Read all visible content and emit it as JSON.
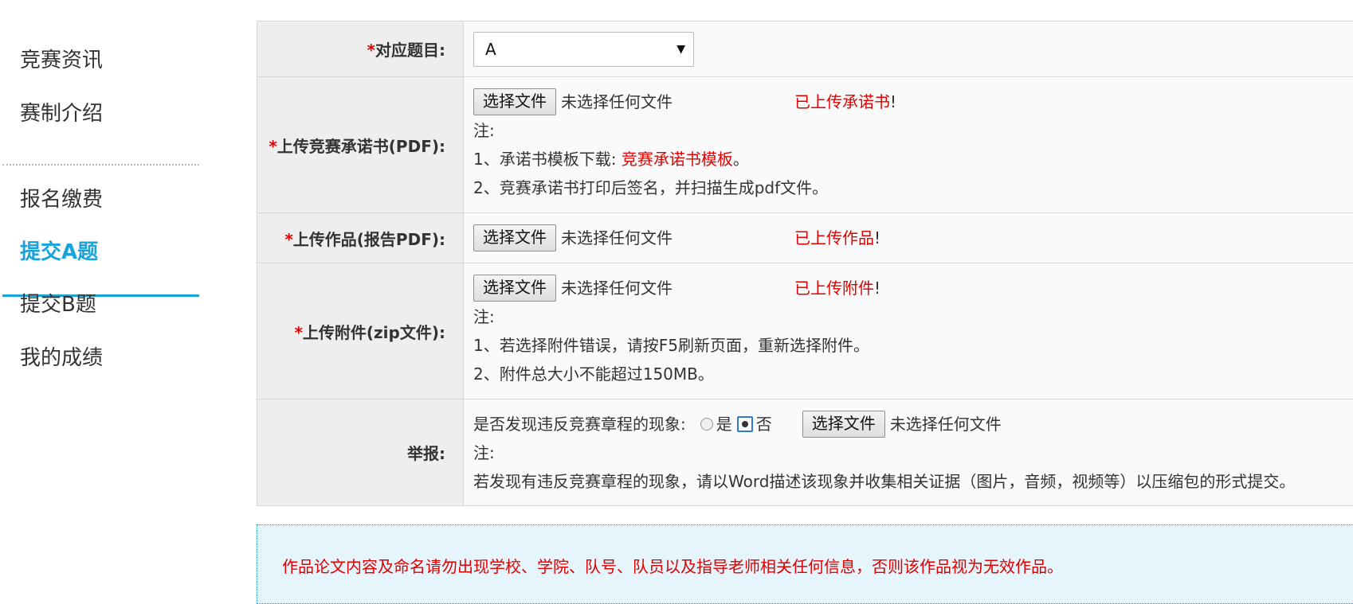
{
  "sidebar": {
    "items": [
      {
        "label": "竞赛资讯"
      },
      {
        "label": "赛制介绍"
      },
      {
        "label": "报名缴费"
      },
      {
        "label": "提交A题"
      },
      {
        "label": "提交B题"
      },
      {
        "label": "我的成绩"
      }
    ],
    "active_index": 3
  },
  "form": {
    "required_mark": "*",
    "topic": {
      "label": "对应题目:",
      "selected": "A",
      "arrow": "▼"
    },
    "file_button": "选择文件",
    "no_file": "未选择任何文件",
    "commitment": {
      "label": "上传竞赛承诺书(PDF):",
      "status": "已上传承诺书",
      "note_title": "注:",
      "note1_prefix": "1、承诺书模板下载:",
      "note1_link": "竞赛承诺书模板",
      "note1_suffix": "。",
      "note2": "2、竞赛承诺书打印后签名，并扫描生成pdf文件。"
    },
    "work": {
      "label": "上传作品(报告PDF):",
      "status": "已上传作品"
    },
    "attachment": {
      "label": "上传附件(zip文件):",
      "status": "已上传附件",
      "note_title": "注:",
      "note1": "1、若选择附件错误，请按F5刷新页面，重新选择附件。",
      "note2": "2、附件总大小不能超过150MB。"
    },
    "report": {
      "label": "举报:",
      "question": "是否发现违反竞赛章程的现象:",
      "yes": "是",
      "no": "否",
      "selected": "否",
      "note_title": "注:",
      "note": "若发现有违反竞赛章程的现象，请以Word描述该现象并收集相关证据（图片，音频，视频等）以压缩包的形式提交。"
    },
    "exclaim": "!"
  },
  "notice": {
    "text": "作品论文内容及命名请勿出现学校、学院、队号、队员以及指导老师相关任何信息，否则该作品视为无效作品。"
  },
  "colors": {
    "accent": "#1aa3d9",
    "required": "#e00000",
    "label_bg": "#eeeeee",
    "notice_bg": "#e6f4fb"
  }
}
